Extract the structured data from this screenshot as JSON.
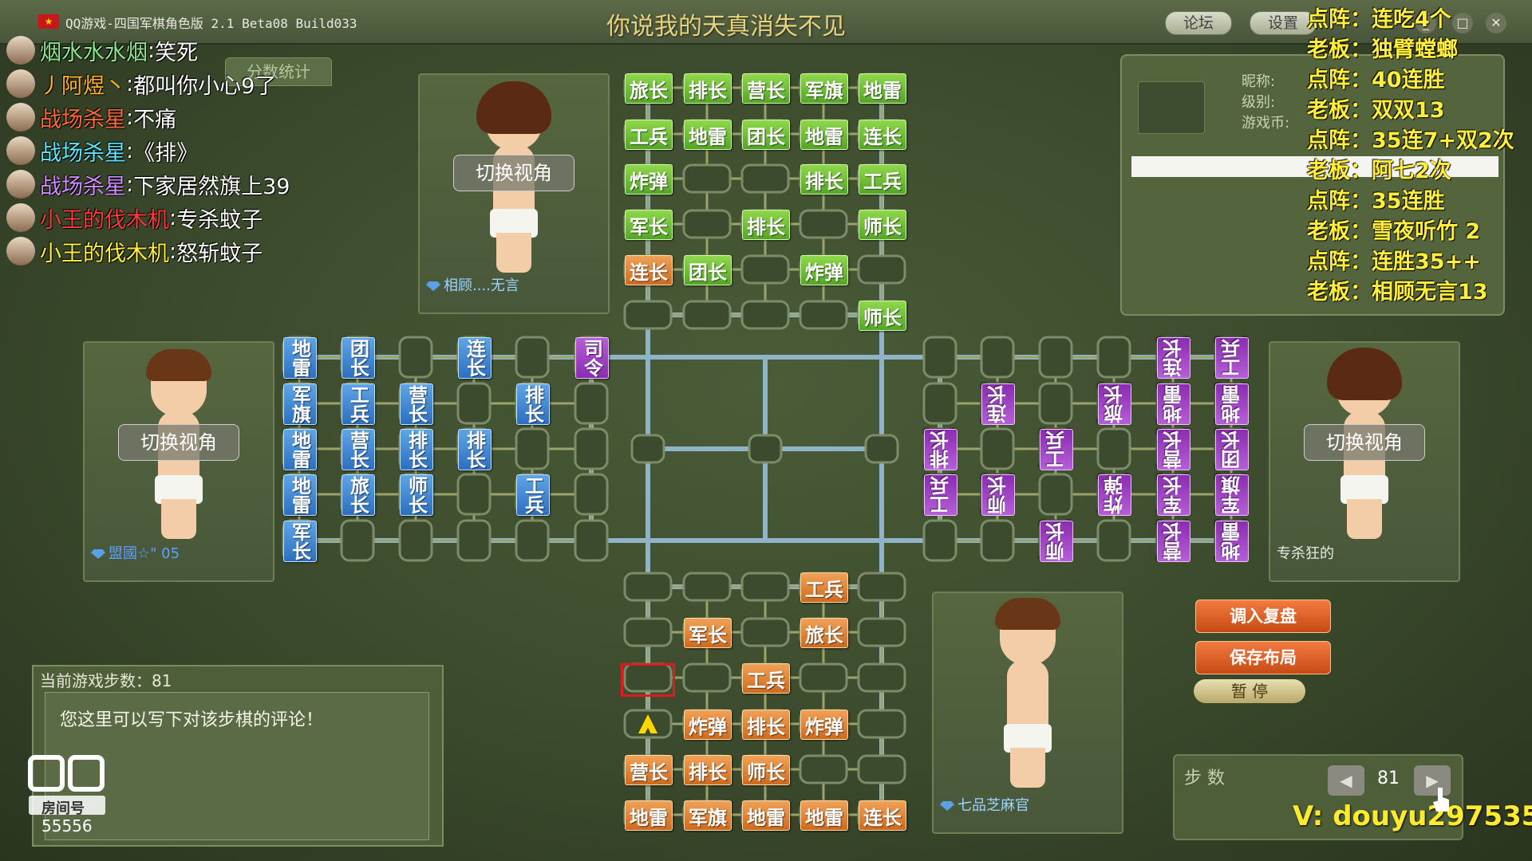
{
  "app": {
    "title": "QQ游戏-四国军棋角色版 2.1 Beta08 Build033",
    "song": "你说我的天真消失不见",
    "forum_btn": "论坛",
    "settings_btn": "设置",
    "min_label": "_",
    "max_label": "□",
    "close_label": "✕"
  },
  "chat": [
    {
      "user": "烟水水水烟",
      "msg": "笑死",
      "color": "#8ee88e"
    },
    {
      "user": "丿阿煜丶",
      "msg": "都叫你小心9了",
      "color": "#ffb22c"
    },
    {
      "user": "战场杀星",
      "msg": "不痛",
      "color": "#ff6a3c"
    },
    {
      "user": "战场杀星",
      "msg": "《排》",
      "color": "#5fe6ff"
    },
    {
      "user": "战场杀星",
      "msg": "下家居然旗上39",
      "color": "#d18cff"
    },
    {
      "user": "小王的伐木机",
      "msg": "专杀蚊子",
      "color": "#ff3a3a"
    },
    {
      "user": "小王的伐木机",
      "msg": "怒斩蚊子",
      "color": "#ffee3c"
    }
  ],
  "score_tab": "分数统计",
  "players": {
    "top": {
      "name": "相顾....无言",
      "switch": "切换视角",
      "name_color": "#9ed4ff"
    },
    "left": {
      "name": "盟國☆\" 05",
      "switch": "切换视角",
      "name_color": "#5aa0ff"
    },
    "right": {
      "name": "专杀狂的",
      "switch": "切换视角",
      "name_color": "#e8e8e0"
    },
    "bottom": {
      "name": "七品芝麻官",
      "name_color": "#9ed4ff"
    }
  },
  "info_panel": {
    "nickname_label": "昵称:",
    "level_label": "级别:",
    "coins_label": "游戏币:"
  },
  "overlay": [
    {
      "text": "点阵：连吃4个",
      "color": "#ffee3c"
    },
    {
      "text": "老板：独臂螳螂",
      "color": "#ffee3c"
    },
    {
      "text": "点阵：40连胜",
      "color": "#ffee3c"
    },
    {
      "text": "老板：双双13",
      "color": "#ffee3c"
    },
    {
      "text": "点阵：35连7+双2次",
      "color": "#ffee3c"
    },
    {
      "text": "老板：阿七2次",
      "color": "#ffee3c"
    },
    {
      "text": "点阵：35连胜",
      "color": "#ffee3c"
    },
    {
      "text": "老板：雪夜听竹 2",
      "color": "#ffee3c"
    },
    {
      "text": "点阵：连胜35++",
      "color": "#ffee3c"
    },
    {
      "text": "老板：相顾无言13",
      "color": "#ffee3c"
    }
  ],
  "board": {
    "top_pieces": [
      [
        "旅长",
        "排长",
        "营长",
        "军旗",
        "地雷"
      ],
      [
        "工兵",
        "地雷",
        "团长",
        "地雷",
        "连长"
      ],
      [
        "炸弹",
        "",
        "",
        "排长",
        "工兵"
      ],
      [
        "军长",
        "",
        "排长",
        "",
        "师长"
      ],
      [
        "连长",
        "团长",
        "",
        "炸弹",
        ""
      ],
      [
        "",
        "",
        "",
        "",
        "师长"
      ]
    ],
    "top_orange": [
      [
        4,
        0
      ]
    ],
    "bottom_pieces": [
      [
        "",
        "",
        "",
        "工兵",
        ""
      ],
      [
        "",
        "军长",
        "",
        "旅长",
        ""
      ],
      [
        "",
        "",
        "工兵",
        "",
        ""
      ],
      [
        "",
        "炸弹",
        "排长",
        "炸弹",
        ""
      ],
      [
        "营长",
        "排长",
        "师长",
        "",
        ""
      ],
      [
        "地雷",
        "军旗",
        "地雷",
        "地雷",
        "连长"
      ]
    ],
    "left_pieces": [
      [
        "地雷",
        "团长",
        "",
        "连长",
        "",
        "司令"
      ],
      [
        "军旗",
        "工兵",
        "营长",
        "",
        "排长",
        ""
      ],
      [
        "地雷",
        "营长",
        "排长",
        "排长",
        "",
        ""
      ],
      [
        "地雷",
        "旅长",
        "师长",
        "",
        "工兵",
        ""
      ],
      [
        "军长",
        "",
        "",
        "",
        "",
        ""
      ]
    ],
    "right_pieces": [
      [
        "",
        "",
        "",
        "",
        "连长",
        "工兵"
      ],
      [
        "",
        "连长",
        "",
        "旅长",
        "地雷",
        "地雷"
      ],
      [
        "排长",
        "",
        "工兵",
        "",
        "营长",
        "团长"
      ],
      [
        "工兵",
        "师长",
        "",
        "炸弹",
        "军长",
        "军旗"
      ],
      [
        "",
        "",
        "师长",
        "",
        "营长",
        "地雷"
      ]
    ],
    "marker_icon": "up-arrow-icon"
  },
  "comment": {
    "steps_label": "当前游戏步数：81",
    "placeholder": "您这里可以写下对该步棋的评论！"
  },
  "douyu": {
    "room_label": "房间号",
    "room_number": "55556"
  },
  "buttons": {
    "load_replay": "调入复盘",
    "save_layout": "保存布局",
    "pause": "暂 停"
  },
  "steps": {
    "label": "步  数",
    "value": "81",
    "prev": "◀",
    "next": "▶"
  },
  "vx": "V: douyu297535"
}
